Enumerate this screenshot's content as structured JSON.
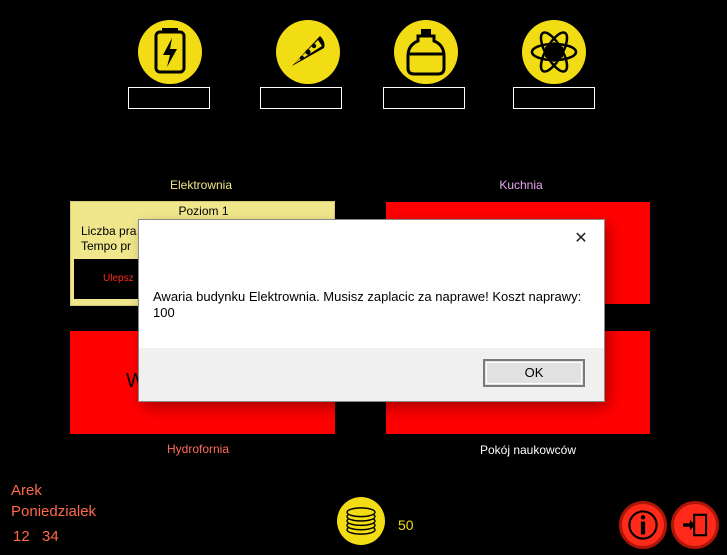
{
  "resources": [
    {
      "icon": "energy-icon",
      "value": ""
    },
    {
      "icon": "food-icon",
      "value": ""
    },
    {
      "icon": "water-icon",
      "value": ""
    },
    {
      "icon": "science-icon",
      "value": ""
    }
  ],
  "buildings": {
    "power_plant": {
      "label": "Elektrownia",
      "level": "Poziom 1",
      "workers_label": "Liczba pra",
      "rate_label": "Tempo pr",
      "upgrade_label": "Ulepsz"
    },
    "kitchen": {
      "label": "Kuchnia"
    },
    "hydroponics": {
      "label": "Hydrofornia",
      "partial_text": "W"
    },
    "lab": {
      "label": "Pokój naukowców"
    }
  },
  "player": {
    "name": "Arek",
    "day": "Poniedzialek",
    "hour": "12",
    "minute": "34"
  },
  "coins": {
    "value": "50"
  },
  "dialog": {
    "message": "Awaria budynku Elektrownia. Musisz zaplacic za naprawe! Koszt naprawy: 100",
    "ok_label": "OK",
    "close_glyph": "✕"
  },
  "colors": {
    "accent_yellow": "#f2dc13",
    "panel_red": "#ff0000",
    "level_panel": "#f0e68c",
    "label_power": "#f0e68c",
    "label_kitchen": "#e9a7f0",
    "label_hydro": "#ff6a5a",
    "label_lab": "#ffffff",
    "player_text": "#ff6a4a"
  }
}
